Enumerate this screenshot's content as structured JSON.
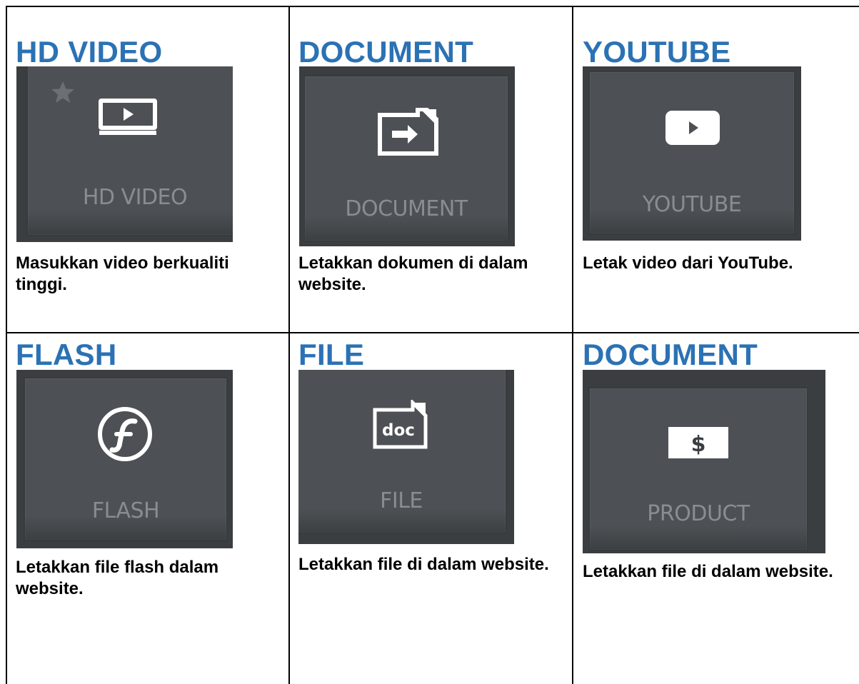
{
  "colors": {
    "title_blue": "#2b72b4",
    "tile_face": "#4d5155",
    "tile_label": "#8a8d90",
    "tile_icon": "#ffffff"
  },
  "cells": [
    {
      "title": "HD VIDEO",
      "tile_label": "HD VIDEO",
      "icon": "hd-video-icon",
      "description": "Masukkan video berkualiti tinggi."
    },
    {
      "title": "DOCUMENT",
      "tile_label": "DOCUMENT",
      "icon": "document-icon",
      "description": "Letakkan dokumen di dalam website."
    },
    {
      "title": "YOUTUBE",
      "tile_label": "YOUTUBE",
      "icon": "youtube-icon",
      "description": "Letak video dari YouTube."
    },
    {
      "title": "FLASH",
      "tile_label": "FLASH",
      "icon": "flash-icon",
      "description": "Letakkan file flash dalam website."
    },
    {
      "title": "FILE",
      "tile_label": "FILE",
      "icon": "file-icon",
      "description": "Letakkan file di dalam website.",
      "icon_text": "doc"
    },
    {
      "title": "DOCUMENT",
      "tile_label": "PRODUCT",
      "icon": "product-icon",
      "description": "Letakkan file di dalam website.",
      "icon_text": "$"
    }
  ]
}
